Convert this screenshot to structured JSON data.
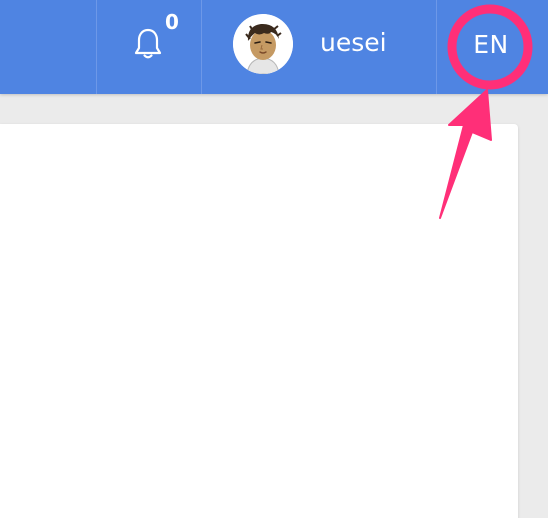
{
  "header": {
    "notifications": {
      "icon": "bell-icon",
      "count": "0"
    },
    "user": {
      "avatar_icon": "user-avatar",
      "name": "uesei"
    },
    "language": {
      "label": "EN"
    }
  },
  "annotation": {
    "color": "#ff2f78",
    "shape": "circle-and-arrow"
  },
  "colors": {
    "header_bg": "#4f84e2",
    "page_bg": "#ebebeb",
    "card_bg": "#ffffff"
  }
}
